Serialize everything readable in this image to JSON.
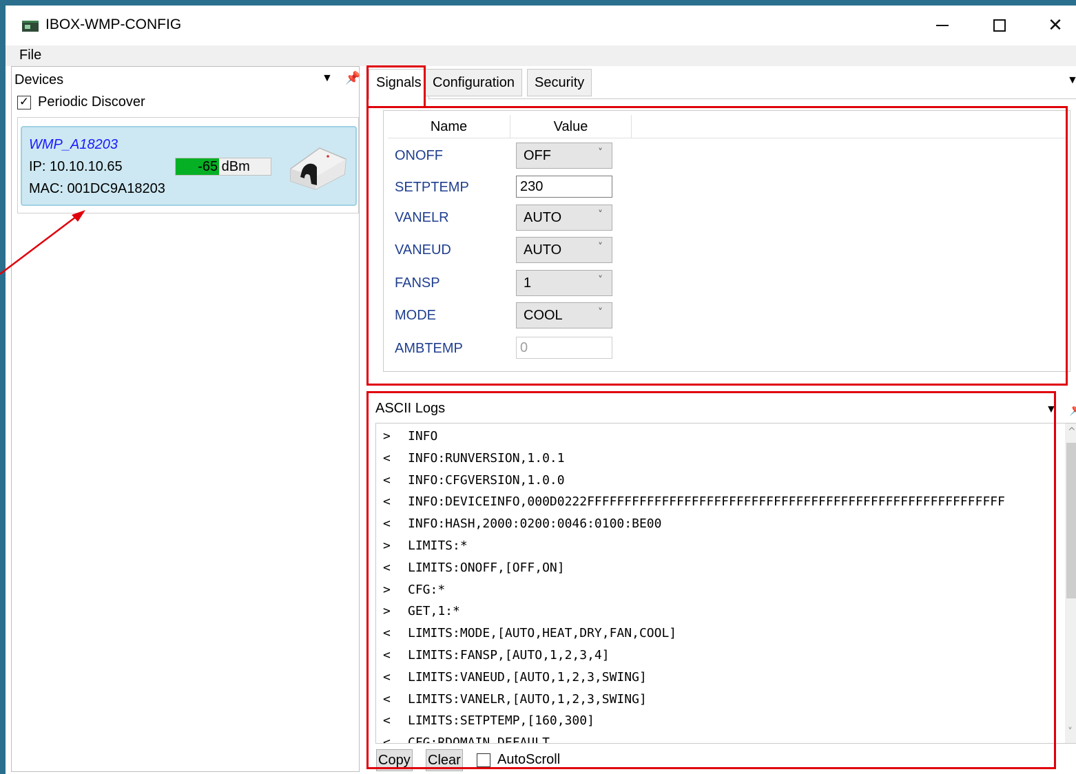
{
  "window": {
    "title": "IBOX-WMP-CONFIG",
    "minimize_icon": "minimize-icon",
    "maximize_icon": "maximize-icon",
    "close_icon": "close-icon",
    "close_glyph": "✕"
  },
  "menu": {
    "file": "File"
  },
  "devices": {
    "header": "Devices",
    "dropdown_glyph": "▼",
    "pin_glyph": "ᵼ",
    "periodic_discover": {
      "label": "Periodic Discover",
      "checked": true,
      "check_glyph": "✓"
    },
    "items": [
      {
        "name": "WMP_A18203",
        "ip": "IP: 10.10.10.65",
        "mac": "MAC: 001DC9A18203",
        "signal_value": "-65",
        "signal_unit": "dBm",
        "signal_level": 0.46
      }
    ]
  },
  "tabs": {
    "signals": "Signals",
    "configuration": "Configuration",
    "security": "Security",
    "selected": "Signals",
    "overflow_glyph": "▼"
  },
  "signals": {
    "columns": {
      "name": "Name",
      "value": "Value"
    },
    "rows": [
      {
        "name": "ONOFF",
        "value": "OFF",
        "kind": "combo"
      },
      {
        "name": "SETPTEMP",
        "value": "230",
        "kind": "text"
      },
      {
        "name": "VANELR",
        "value": "AUTO",
        "kind": "combo"
      },
      {
        "name": "VANEUD",
        "value": "AUTO",
        "kind": "combo"
      },
      {
        "name": "FANSP",
        "value": "1",
        "kind": "combo"
      },
      {
        "name": "MODE",
        "value": "COOL",
        "kind": "combo"
      },
      {
        "name": "AMBTEMP",
        "value": "0",
        "kind": "text-disabled"
      }
    ],
    "chevron_glyph": "˅"
  },
  "logs": {
    "title": "ASCII Logs",
    "dropdown_glyph": "▼",
    "pin_glyph": "ᵼ",
    "lines": [
      {
        "dir": ">",
        "text": "INFO"
      },
      {
        "dir": "<",
        "text": "INFO:RUNVERSION,1.0.1"
      },
      {
        "dir": "<",
        "text": "INFO:CFGVERSION,1.0.0"
      },
      {
        "dir": "<",
        "text": "INFO:DEVICEINFO,000D0222FFFFFFFFFFFFFFFFFFFFFFFFFFFFFFFFFFFFFFFFFFFFFFFFFFFFFFFF"
      },
      {
        "dir": "<",
        "text": "INFO:HASH,2000:0200:0046:0100:BE00"
      },
      {
        "dir": ">",
        "text": "LIMITS:*"
      },
      {
        "dir": "<",
        "text": "LIMITS:ONOFF,[OFF,ON]"
      },
      {
        "dir": ">",
        "text": "CFG:*"
      },
      {
        "dir": ">",
        "text": "GET,1:*"
      },
      {
        "dir": "<",
        "text": "LIMITS:MODE,[AUTO,HEAT,DRY,FAN,COOL]"
      },
      {
        "dir": "<",
        "text": "LIMITS:FANSP,[AUTO,1,2,3,4]"
      },
      {
        "dir": "<",
        "text": "LIMITS:VANEUD,[AUTO,1,2,3,SWING]"
      },
      {
        "dir": "<",
        "text": "LIMITS:VANELR,[AUTO,1,2,3,SWING]"
      },
      {
        "dir": "<",
        "text": "LIMITS:SETPTEMP,[160,300]"
      },
      {
        "dir": "<",
        "text": "CFG:RDOMAIN,DEFAULT"
      }
    ],
    "copy": "Copy",
    "clear": "Clear",
    "autoscroll": {
      "label": "AutoScroll",
      "checked": false
    },
    "scroll_up_glyph": "^",
    "scroll_down_glyph": "˅"
  },
  "colors": {
    "annotation": "#e0000b",
    "device_name": "#1a1aff",
    "signal_label": "#1f3f8f",
    "signal_fill": "#06b025",
    "card_bg": "#cde8f2"
  }
}
